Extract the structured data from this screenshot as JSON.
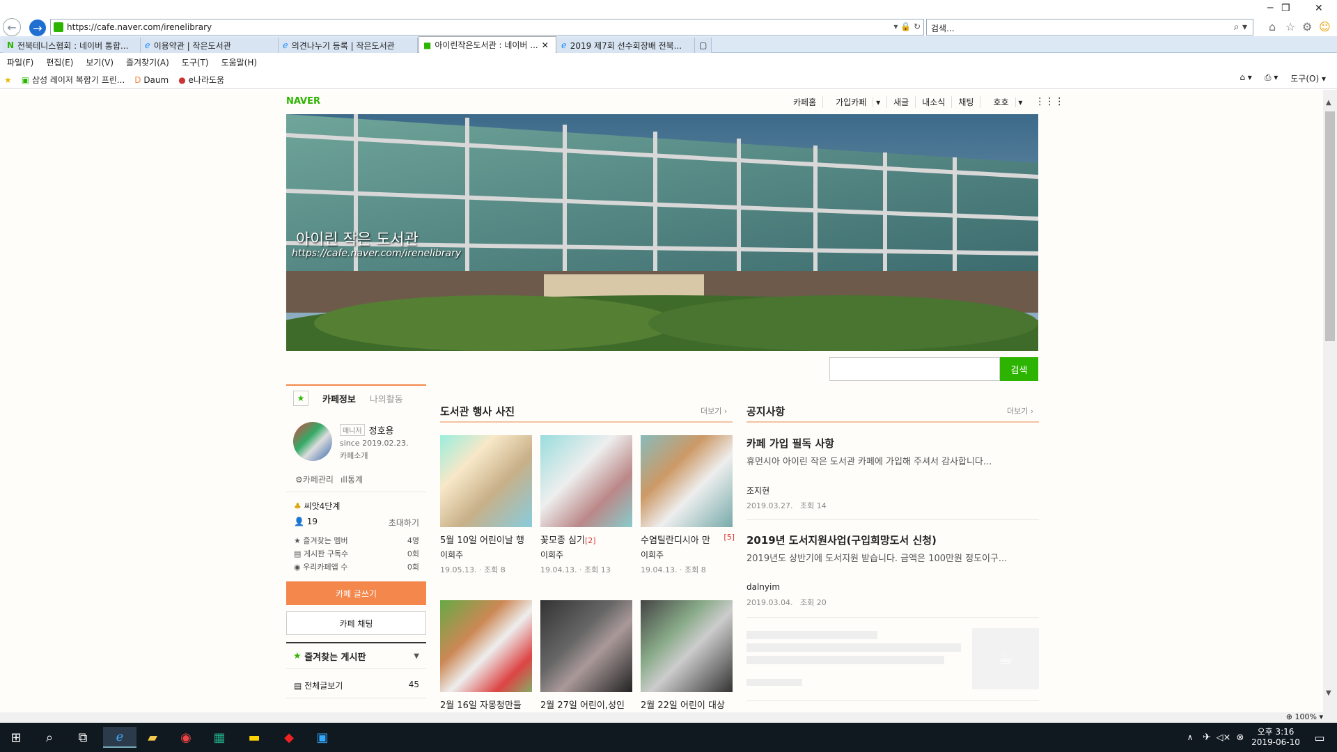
{
  "browser": {
    "url": "https://cafe.naver.com/irenelibrary",
    "search_placeholder": "검색...",
    "tabs": [
      "전북테니스협회 : 네이버 통합...",
      "이용약관 | 작은도서관",
      "의견나누기 등록 | 작은도서관",
      "아이린작은도서관 : 네이버 ...",
      "2019 제7회 선수회장배 전북..."
    ],
    "menu": [
      "파일(F)",
      "편집(E)",
      "보기(V)",
      "즐겨찾기(A)",
      "도구(T)",
      "도움말(H)"
    ],
    "favorites": [
      "삼성 레이저 복합기 프린...",
      "Daum",
      "e나라도움"
    ],
    "tools_label": "도구(O)",
    "zoom": "100%"
  },
  "cafe": {
    "logo": "NAVER",
    "nav": [
      "카페홈",
      "가입카페",
      "새글",
      "내소식",
      "채팅",
      "호호"
    ],
    "banner_title": "아이린 작은 도서관",
    "banner_url": "https://cafe.naver.com/irenelibrary",
    "search_button": "검색",
    "side_tabs": [
      "카페정보",
      "나의활동"
    ],
    "manager_badge": "매니저",
    "manager_name": "정호용",
    "since": "since 2019.02.23.",
    "intro": "카페소개",
    "admin": "카페관리",
    "stats": "통계",
    "level": "씨앗4단계",
    "members": "19",
    "invite": "초대하기",
    "counts": [
      {
        "label": "즐겨찾는 멤버",
        "value": "4명"
      },
      {
        "label": "게시판 구독수",
        "value": "0회"
      },
      {
        "label": "우리카페앱 수",
        "value": "0회"
      }
    ],
    "write_button": "카페 글쓰기",
    "chat_button": "카페 채팅",
    "fav_board": "즐겨찾는 게시판",
    "all_posts": "전체글보기",
    "all_posts_count": "45",
    "events": {
      "title": "도서관 행사 사진",
      "more": "더보기",
      "items": [
        {
          "cap": "5월 10일 어린이날 행",
          "count": "",
          "author": "이희주",
          "date": "19.05.13.",
          "views": "조회 8"
        },
        {
          "cap": "꽃모종 심기",
          "count": "[2]",
          "author": "이희주",
          "date": "19.04.13.",
          "views": "조회 13"
        },
        {
          "cap": "수염틸란디시아 만",
          "count": "[5]",
          "author": "이희주",
          "date": "19.04.13.",
          "views": "조회 8"
        },
        {
          "cap": "2월 16일 자몽청만들",
          "count": "",
          "author": "",
          "date": "",
          "views": ""
        },
        {
          "cap": "2월 27일 어린이,성인",
          "count": "",
          "author": "",
          "date": "",
          "views": ""
        },
        {
          "cap": "2월 22일 어린이 대상",
          "count": "",
          "author": "",
          "date": "",
          "views": ""
        }
      ]
    },
    "notice": {
      "title": "공지사항",
      "more": "더보기",
      "items": [
        {
          "title": "카페 가입 필독 사항",
          "desc": "휴먼시아 아이린 작은 도서관 카페에 가입해 주셔서 감사합니다...",
          "author": "조지현",
          "date": "2019.03.27.",
          "views": "조회 14"
        },
        {
          "title": "2019년 도서지원사업(구입희망도서 신청)",
          "desc": "2019년도 상반기에 도서지원 받습니다. 금액은 100만원 정도이구...",
          "author": "dalnyim",
          "date": "2019.03.04.",
          "views": "조회 20"
        }
      ]
    }
  },
  "taskbar": {
    "time": "오후 3:16",
    "date": "2019-06-10"
  }
}
